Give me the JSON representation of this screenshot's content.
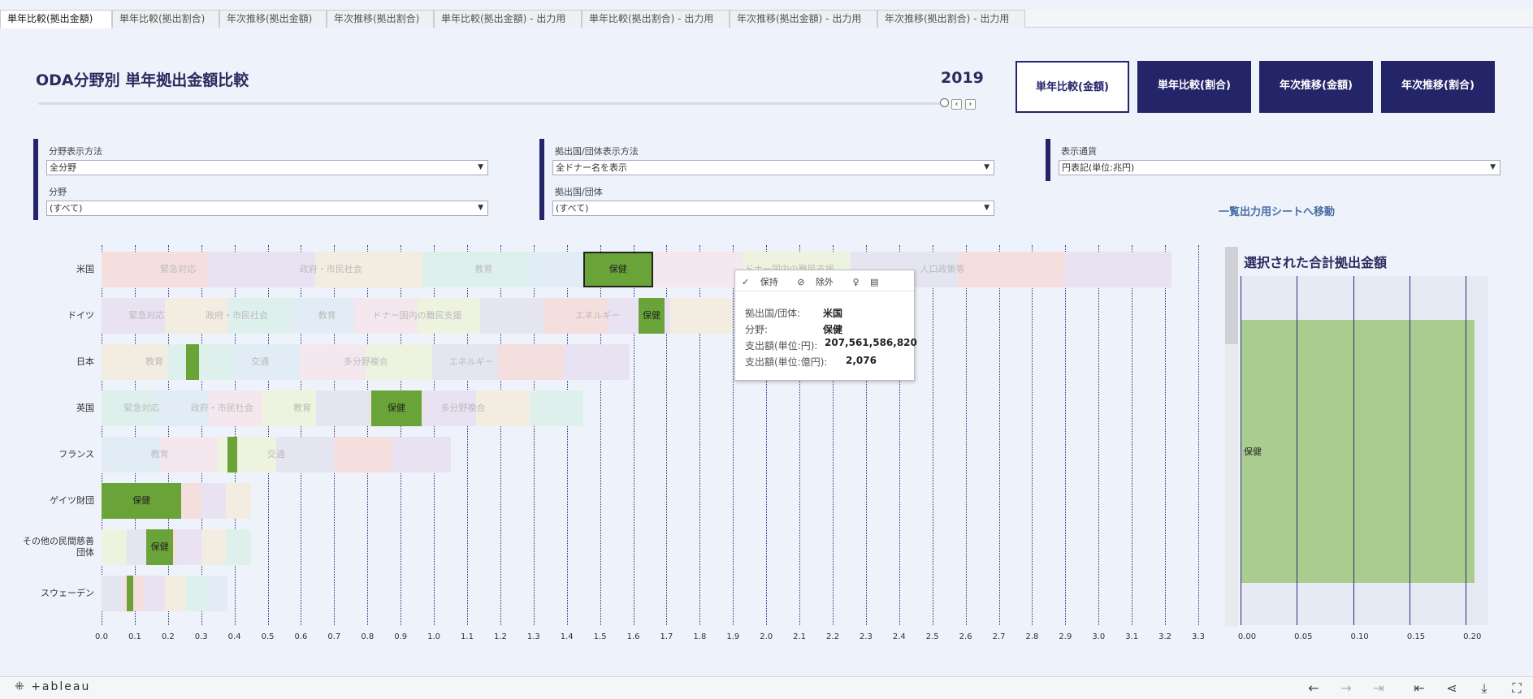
{
  "tabs": [
    "単年比較(拠出金額)",
    "単年比較(拠出割合)",
    "年次推移(拠出金額)",
    "年次推移(拠出割合)",
    "単年比較(拠出金額) - 出力用",
    "単年比較(拠出割合) - 出力用",
    "年次推移(拠出金額) - 出力用",
    "年次推移(拠出割合) - 出力用"
  ],
  "header": {
    "title": "ODA分野別 単年拠出金額比較",
    "year": "2019",
    "prev": "‹",
    "next": "›"
  },
  "nav_buttons": [
    "単年比較(金額)",
    "単年比較(割合)",
    "年次推移(金額)",
    "年次推移(割合)"
  ],
  "filters": {
    "field_display_label": "分野表示方法",
    "field_display_value": "全分野",
    "field_label": "分野",
    "field_value": "(すべて)",
    "donor_display_label": "拠出国/団体表示方法",
    "donor_display_value": "全ドナー名を表示",
    "donor_label": "拠出国/団体",
    "donor_value": "(すべて)",
    "currency_label": "表示通貨",
    "currency_value": "円表記(単位:兆円)"
  },
  "goto_link": "一覧出力用シートへ移動",
  "chart_data": {
    "type": "bar",
    "stacked": true,
    "orientation": "horizontal",
    "categories": [
      "米国",
      "ドイツ",
      "日本",
      "英国",
      "フランス",
      "ゲイツ財団",
      "その他の民間慈善団体",
      "スウェーデン"
    ],
    "totals": [
      3.22,
      1.9,
      1.59,
      1.45,
      1.05,
      0.45,
      0.45,
      0.38
    ],
    "highlighted_field": "保健",
    "highlight_values": [
      0.21,
      0.08,
      0.04,
      0.15,
      0.03,
      0.24,
      0.08,
      0.02
    ],
    "segment_labels": [
      [
        "緊急対応",
        "政府・市民社会",
        "教育",
        "保健",
        "ドナー国内の難民支援",
        "人口政策等"
      ],
      [
        "緊急対応",
        "政府・市民社会",
        "教育",
        "ドナー国内の難民支援",
        "保健",
        "エネルギー"
      ],
      [
        "教育",
        "交通",
        "多分野複合",
        "エネルギー"
      ],
      [
        "緊急対応",
        "政府・市民社会",
        "教育",
        "保健",
        "多分野複合"
      ],
      [
        "教育",
        "交通"
      ],
      [
        "保健"
      ],
      [
        "保健"
      ],
      []
    ],
    "xlim": [
      0,
      3.3
    ],
    "xticks": [
      "0.0",
      "0.1",
      "0.2",
      "0.3",
      "0.4",
      "0.5",
      "0.6",
      "0.7",
      "0.8",
      "0.9",
      "1.0",
      "1.1",
      "1.2",
      "1.3",
      "1.4",
      "1.5",
      "1.6",
      "1.7",
      "1.8",
      "1.9",
      "2.0",
      "2.1",
      "2.2",
      "2.3",
      "2.4",
      "2.5",
      "2.6",
      "2.7",
      "2.8",
      "2.9",
      "3.0",
      "3.1",
      "3.2",
      "3.3"
    ],
    "colors": {
      "highlight": "#6aa337",
      "faded": [
        "#f5dede",
        "#e8e2f3",
        "#f3ece0",
        "#def0ec",
        "#e2ecf6",
        "#f4e8ee",
        "#eef3df",
        "#e5e5f2"
      ]
    }
  },
  "tooltip": {
    "keep": "保持",
    "exclude": "除外",
    "donor_label": "拠出国/団体:",
    "donor_value": "米国",
    "field_label": "分野:",
    "field_value": "保健",
    "yen_label": "支出額(単位:円):",
    "yen_value": "207,561,586,820",
    "oku_label": "支出額(単位:億円):",
    "oku_value": "2,076"
  },
  "right_chart": {
    "title": "選択された合計拠出金額",
    "bar_label": "保健",
    "value": 0.2076,
    "xlim": [
      0,
      0.22
    ],
    "xticks": [
      "0.00",
      "0.05",
      "0.10",
      "0.15",
      "0.20"
    ]
  },
  "footer": {
    "logo": "⁜ +ableau"
  }
}
